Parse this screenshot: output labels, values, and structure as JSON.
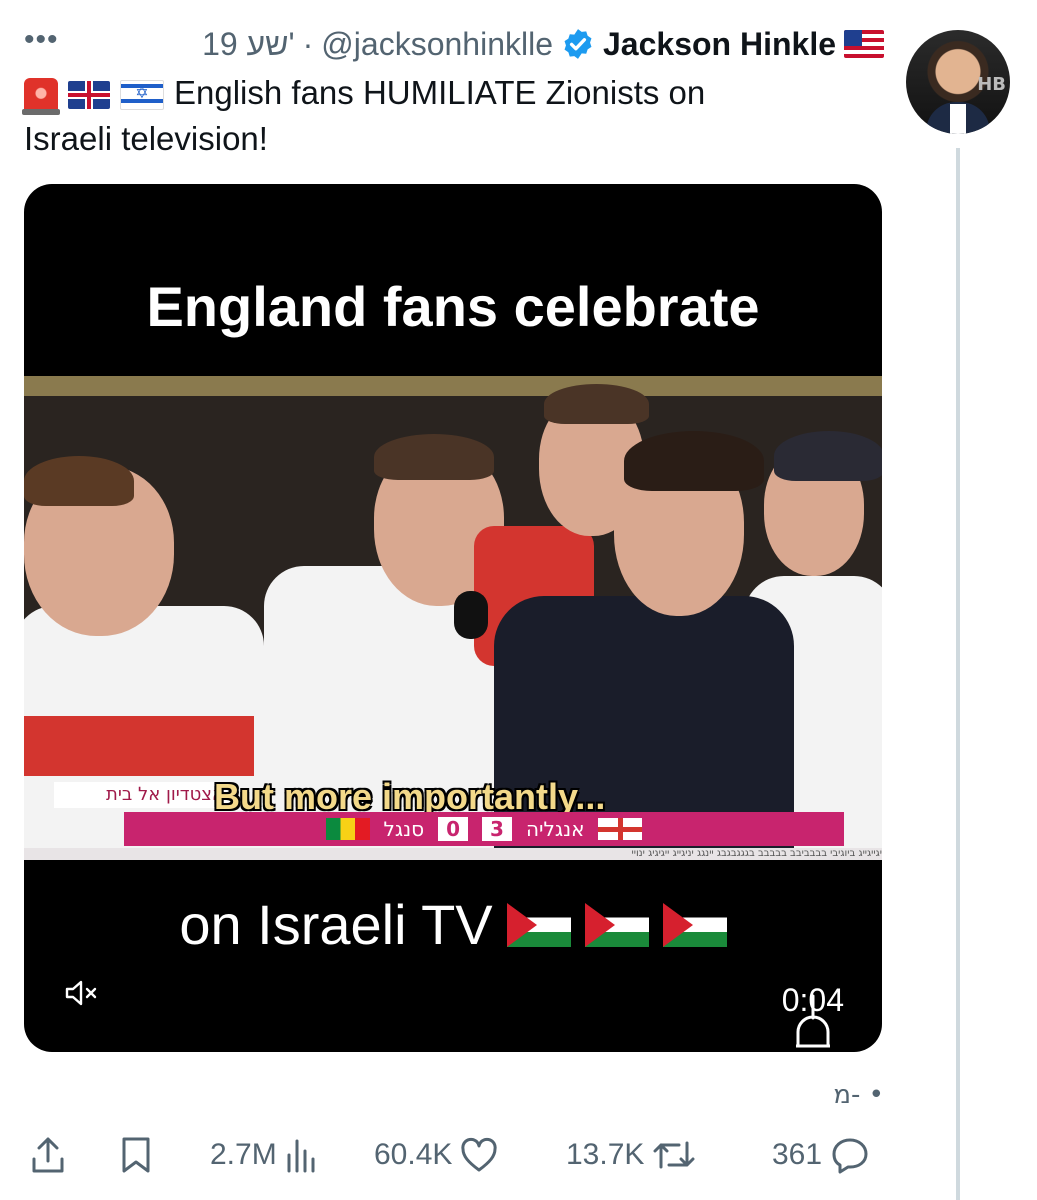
{
  "header": {
    "more": "•••",
    "time": "19 שע'",
    "separator": "·",
    "handle": "@jacksonhinklle",
    "display_name": "Jackson Hinkle"
  },
  "tweet": {
    "text_line1": "English fans HUMILIATE Zionists on",
    "text_line2": "Israeli television!",
    "emojis": [
      "siren-icon",
      "uk-flag-icon",
      "israel-flag-icon"
    ]
  },
  "video": {
    "top_caption": "England fans celebrate",
    "bottom_caption": "on Israeli TV",
    "subtitle": "But more importantly...",
    "ticker_left": "אצטדיון אל בית",
    "score": {
      "team_left": "אנגליה",
      "score_left": "3",
      "score_right": "0",
      "team_right": "סנגל"
    },
    "crawl_text": "יגייגייג ביוגיבי בבבביבב בבבבב בגגגבגבג יינגג יניגייג ייגיגיג ינויי",
    "duration": "0:04",
    "muted": true
  },
  "meta": {
    "translate_label": "מ- •"
  },
  "actions": {
    "views": "2.7M",
    "likes": "60.4K",
    "retweets": "13.7K",
    "replies": "361"
  },
  "colors": {
    "verified": "#1d9bf0",
    "secondary_text": "#536471",
    "thread_line": "#cfd9de"
  }
}
